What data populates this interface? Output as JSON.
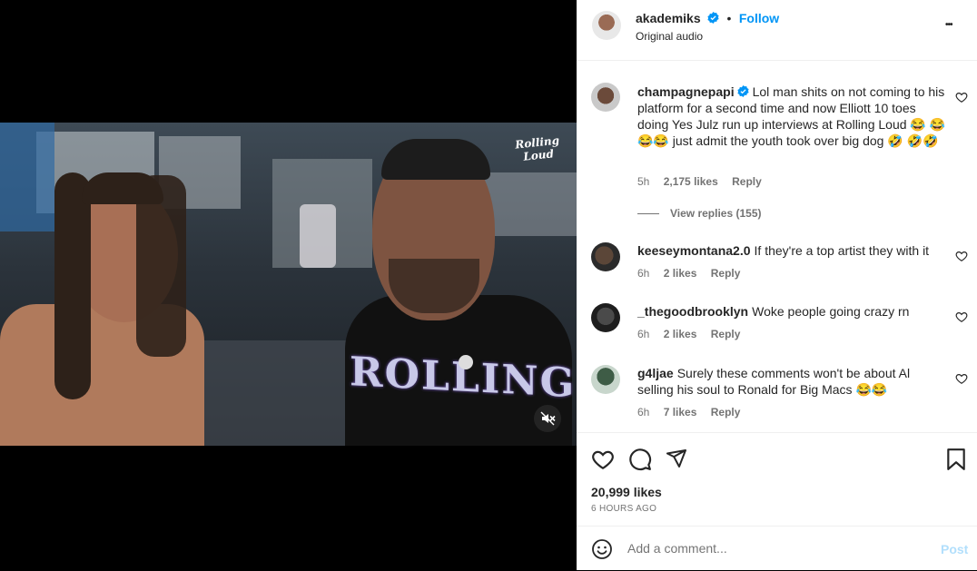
{
  "post": {
    "author": "akademiks",
    "follow_label": "Follow",
    "dot": "•",
    "audio": "Original audio",
    "more_label": "•••",
    "likes": "20,999 likes",
    "time": "6 HOURS AGO"
  },
  "video": {
    "watermark_line1": "Rolling",
    "watermark_line2": "Loud",
    "shirt_text": "ROLLING",
    "mute_icon": "speaker-muted-icon"
  },
  "comments": [
    {
      "user": "champagnepapi",
      "verified": true,
      "text": "Lol man shits on not coming to his platform for a second time and now Elliott 10 toes doing Yes Julz run up interviews at Rolling Loud 😂 😂😂😂 just admit the youth took over big dog 🤣 🤣🤣",
      "time": "5h",
      "likes": "2,175 likes",
      "reply": "Reply",
      "view_replies": "View replies (155)"
    },
    {
      "user": "keeseymontana2.0",
      "text": "If they're a top artist they with it",
      "time": "6h",
      "likes": "2 likes",
      "reply": "Reply"
    },
    {
      "user": "_thegoodbrooklyn",
      "text": "Woke people going crazy rn",
      "time": "6h",
      "likes": "2 likes",
      "reply": "Reply"
    },
    {
      "user": "g4ljae",
      "text": "Surely these comments won't be about Al selling his soul to Ronald for Big Macs 😂😂",
      "time": "6h",
      "likes": "7 likes",
      "reply": "Reply"
    }
  ],
  "composer": {
    "placeholder": "Add a comment...",
    "post_label": "Post"
  },
  "colors": {
    "link_blue": "#0095f6",
    "post_disabled": "#b2dffc",
    "verified_blue": "#0095f6"
  },
  "icons": [
    "heart-icon",
    "comment-icon",
    "share-icon",
    "bookmark-icon",
    "emoji-icon",
    "more-options-icon",
    "verified-badge-icon"
  ]
}
